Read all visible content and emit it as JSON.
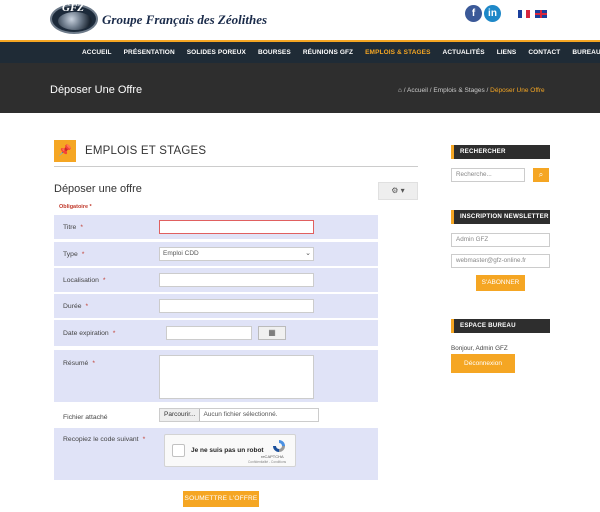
{
  "header": {
    "logo_text": "GFZ",
    "site_title": "Groupe Français des Zéolithes",
    "social": {
      "facebook": "f",
      "linkedin": "in"
    },
    "languages": [
      "fr-flag",
      "en-flag"
    ]
  },
  "nav": {
    "items": [
      "ACCUEIL",
      "PRÉSENTATION",
      "SOLIDES POREUX",
      "BOURSES",
      "RÉUNIONS GFZ",
      "EMPLOIS & STAGES",
      "ACTUALITÉS",
      "LIENS",
      "CONTACT",
      "BUREAU"
    ],
    "active": "EMPLOIS & STAGES",
    "accent_color": "#f5a623"
  },
  "page": {
    "title": "Déposer Une Offre",
    "breadcrumb": [
      "Accueil",
      "Emplois & Stages",
      "Déposer Une Offre"
    ]
  },
  "section": {
    "title": "EMPLOIS ET STAGES",
    "icon": "pin-icon"
  },
  "form": {
    "title": "Déposer une offre",
    "required_note": "Obligatoire *",
    "fields": {
      "titre": {
        "label": "Titre",
        "required": "*",
        "value": ""
      },
      "type": {
        "label": "Type",
        "required": "*",
        "value": "Emploi CDD"
      },
      "localisation": {
        "label": "Localisation",
        "required": "*",
        "value": ""
      },
      "duree": {
        "label": "Durée",
        "required": "*",
        "value": ""
      },
      "date_expiration": {
        "label": "Date expiration",
        "required": "*",
        "value": ""
      },
      "resume": {
        "label": "Résumé",
        "required": "*",
        "value": ""
      },
      "fichier": {
        "label": "Fichier attaché",
        "button": "Parcourir...",
        "status": "Aucun fichier sélectionné."
      },
      "captcha": {
        "label": "Recopiez le code suivant",
        "required": "*",
        "checkbox_text": "Je ne suis pas un robot",
        "brand": "reCAPTCHA",
        "terms": "Confidentialité - Conditions"
      }
    },
    "submit_label": "SOUMETTRE L'OFFRE"
  },
  "sidebar": {
    "search": {
      "heading": "RECHERCHER",
      "placeholder": "Recherche..."
    },
    "newsletter": {
      "heading": "INSCRIPTION NEWSLETTER",
      "name_value": "Admin GFZ",
      "email_value": "webmaster@gfz-online.fr",
      "button": "S'ABONNER"
    },
    "espace": {
      "heading": "ESPACE BUREAU",
      "greeting": "Bonjour, Admin GFZ",
      "button": "Déconnexion"
    }
  }
}
